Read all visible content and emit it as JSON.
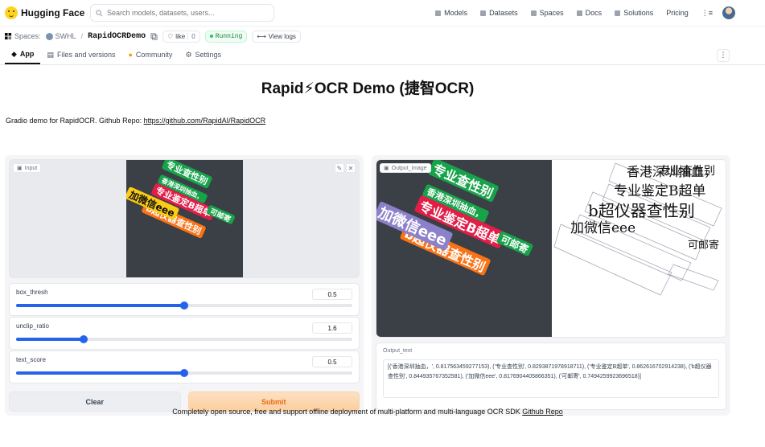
{
  "nav": {
    "brand": "Hugging Face",
    "search_placeholder": "Search models, datasets, users...",
    "links": [
      "Models",
      "Datasets",
      "Spaces",
      "Docs",
      "Solutions",
      "Pricing"
    ],
    "more": "⋮≡"
  },
  "space": {
    "spaces_label": "Spaces:",
    "owner": "SWHL",
    "separator": "/",
    "repo": "RapidOCRDemo",
    "like_label": "like",
    "like_count": "0",
    "status": "Running",
    "view_logs": "View logs"
  },
  "tabs": [
    {
      "label": "App",
      "icon": "app-icon"
    },
    {
      "label": "Files and versions",
      "icon": "files-icon"
    },
    {
      "label": "Community",
      "icon": "community-icon"
    },
    {
      "label": "Settings",
      "icon": "settings-icon"
    }
  ],
  "app": {
    "title": "Rapid⚡OCR Demo (捷智OCR)",
    "description_prefix": "Gradio demo for RapidOCR. Github Repo: ",
    "description_link": "https://github.com/RapidAI/RapidOCR",
    "input_label": "Input",
    "output_image_label": "Output_image",
    "output_text_label": "Output_text",
    "sliders": [
      {
        "label": "box_thresh",
        "value": "0.5",
        "fraction": 0.5
      },
      {
        "label": "unclip_ratio",
        "value": "1.6",
        "fraction": 0.2
      },
      {
        "label": "text_score",
        "value": "0.5",
        "fraction": 0.5
      }
    ],
    "clear_label": "Clear",
    "submit_label": "Submit",
    "output_text": "[('香港深圳抽血，', 0.817563459277153), ('专业查性别', 0.8293871978918711), ('专业鉴定B超单', 0.862616702914238), ('b超仪器查性别', 0.844935767352581), ('加微信eee', 0.8176904405866351), ('可邮寄', 0.7494259923696518)]",
    "footer_prefix": "Completely open source, free and support offline deployment of multi-platform and multi-language OCR SDK ",
    "footer_link": "Github Repo"
  },
  "image_texts": {
    "stickers": [
      "香港深圳抽血，",
      "专业查性别",
      "专业鉴定B超单",
      "b超仪器查性别",
      "加微信eee",
      "可邮寄"
    ],
    "rendered": [
      "香港深圳抽血，",
      "专业查性别",
      "专业鉴定B超单",
      "b超仪器查性别",
      "加微信eee",
      "可邮寄"
    ]
  },
  "colors": {
    "accent_blue": "#2563eb",
    "submit_orange": "#ea6a12",
    "sticker_green": "#16a34a",
    "sticker_red": "#e11d48",
    "sticker_orange": "#f97316",
    "sticker_yellow": "#facc15",
    "sticker_purple": "#8b80c9"
  }
}
